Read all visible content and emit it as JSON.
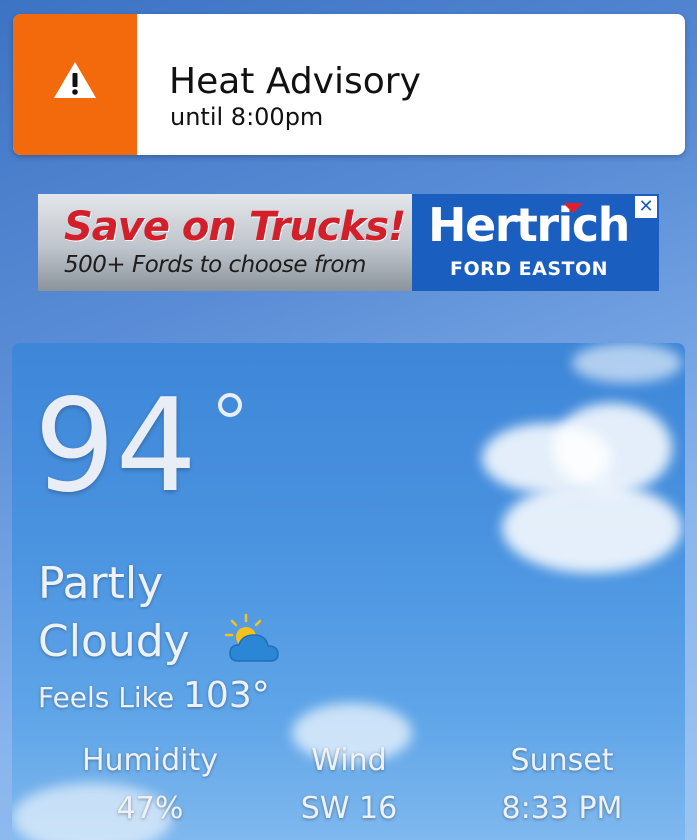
{
  "alert": {
    "title": "Heat Advisory",
    "subtitle": "until 8:00pm",
    "icon": "warning-icon",
    "color": "#f36a0c"
  },
  "ad": {
    "headline": "Save on Trucks!",
    "subline": "500+ Fords to choose from",
    "brand": "Hertrich",
    "location": "FORD EASTON",
    "close": "✕",
    "brand_color": "#1a5fc0",
    "headline_color": "#d21f2a"
  },
  "weather": {
    "temperature": "94",
    "condition_line1": "Partly",
    "condition_line2": "Cloudy",
    "condition_icon": "partly-cloudy-icon",
    "feels_like_label": "Feels Like",
    "feels_like_value": "103°",
    "stats": [
      {
        "label": "Humidity",
        "value": "47%"
      },
      {
        "label": "Wind",
        "value": "SW 16"
      },
      {
        "label": "Sunset",
        "value": "8:33 PM"
      }
    ]
  }
}
